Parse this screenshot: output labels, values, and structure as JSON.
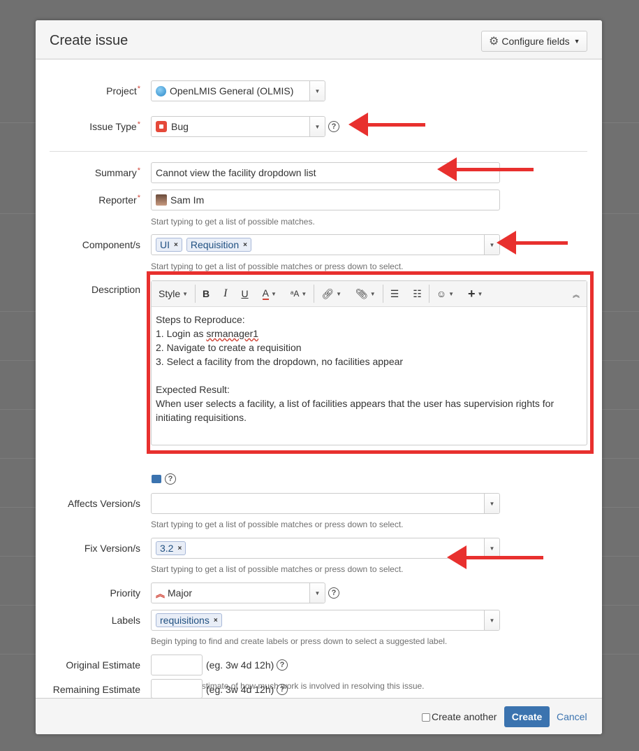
{
  "dialog": {
    "title": "Create issue",
    "configure_label": "Configure fields"
  },
  "fields": {
    "project": {
      "label": "Project",
      "value": "OpenLMIS General (OLMIS)"
    },
    "issue_type": {
      "label": "Issue Type",
      "value": "Bug"
    },
    "summary": {
      "label": "Summary",
      "value": "Cannot view the facility dropdown list"
    },
    "reporter": {
      "label": "Reporter",
      "value": "Sam Im",
      "hint": "Start typing to get a list of possible matches."
    },
    "components": {
      "label": "Component/s",
      "tags": [
        "UI",
        "Requisition"
      ],
      "hint": "Start typing to get a list of possible matches or press down to select."
    },
    "description": {
      "label": "Description",
      "toolbar_style": "Style",
      "lines": [
        "Steps to Reproduce:",
        "1. Login as ",
        "srmanager1",
        "2. Navigate to create a requisition",
        "3. Select a facility from the dropdown, no facilities appear",
        "",
        "Expected Result:",
        "When user selects a facility, a list of facilities appears that the user has supervision rights for",
        "initiating requisitions."
      ]
    },
    "affects_version": {
      "label": "Affects Version/s",
      "value": "",
      "hint": "Start typing to get a list of possible matches or press down to select."
    },
    "fix_version": {
      "label": "Fix Version/s",
      "tags": [
        "3.2"
      ],
      "hint": "Start typing to get a list of possible matches or press down to select."
    },
    "priority": {
      "label": "Priority",
      "value": "Major"
    },
    "labels": {
      "label": "Labels",
      "tags": [
        "requisitions"
      ],
      "hint": "Begin typing to find and create labels or press down to select a suggested label."
    },
    "original_estimate": {
      "label": "Original Estimate",
      "example": "(eg. 3w 4d 12h)",
      "hint": "The original estimate of how much work is involved in resolving this issue."
    },
    "remaining_estimate": {
      "label": "Remaining Estimate",
      "example": "(eg. 3w 4d 12h)"
    }
  },
  "footer": {
    "create_another": "Create another",
    "create": "Create",
    "cancel": "Cancel"
  },
  "colors": {
    "accent": "#3b73af",
    "annotation": "#e8302e",
    "required": "#d04437"
  }
}
